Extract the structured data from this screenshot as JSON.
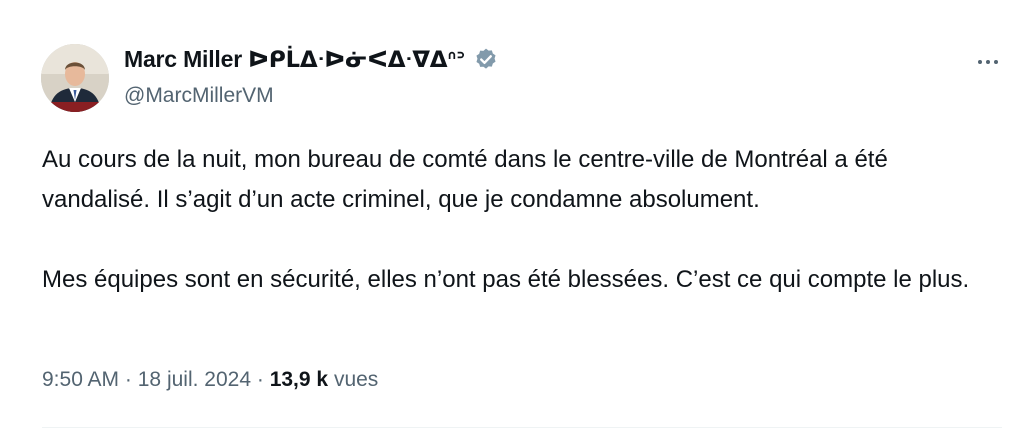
{
  "author": {
    "display_name": "Marc Miller ᐅᑭᒫᐃᐧᐅᓃᐸᐃᐧᐁᐃᐢᐣ",
    "handle": "@MarcMillerVM",
    "verified": true,
    "avatar_icon": "profile-photo"
  },
  "tweet": {
    "paragraph_1": "Au cours de la nuit, mon bureau de comté dans le centre-ville de Montréal a été vandalisé. Il s’agit d’un acte criminel, que je condamne absolument.",
    "paragraph_2": "Mes équipes sont en sécurité, elles n’ont pas été blessées. C’est ce qui compte le plus."
  },
  "meta": {
    "time": "9:50 AM",
    "separator": "·",
    "date": "18 juil. 2024",
    "views_count": "13,9 k",
    "views_label": "vues"
  },
  "icons": {
    "verified": "verified-badge-icon",
    "more": "more-options-icon"
  },
  "colors": {
    "text": "#0f1419",
    "secondary": "#536471",
    "verified_badge": "#829aab",
    "divider": "#eff3f4"
  }
}
